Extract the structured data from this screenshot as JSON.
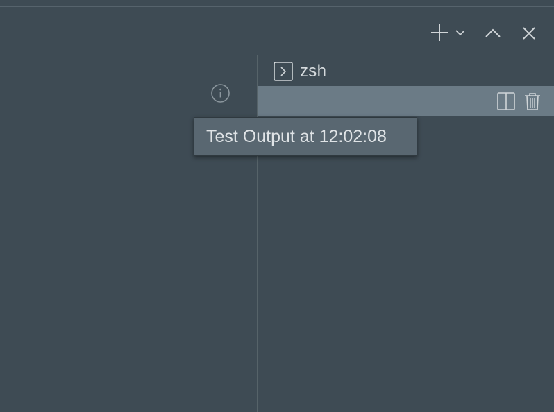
{
  "panel": {
    "header_actions": [
      {
        "icon": "plus-icon"
      },
      {
        "icon": "chevron-down-icon"
      },
      {
        "icon": "chevron-up-icon"
      },
      {
        "icon": "close-icon"
      }
    ]
  },
  "terminal": {
    "tab_label": "zsh",
    "tab_icon": "terminal-icon",
    "row_actions": [
      {
        "icon": "split-pane-icon"
      },
      {
        "icon": "trash-icon"
      }
    ]
  },
  "tooltip": {
    "text": "Test Output at 12:02:08"
  },
  "colors": {
    "background": "#3e4b54",
    "selected_row": "#6b7b86",
    "tooltip_bg": "#596771",
    "icon": "#c9ced2"
  }
}
